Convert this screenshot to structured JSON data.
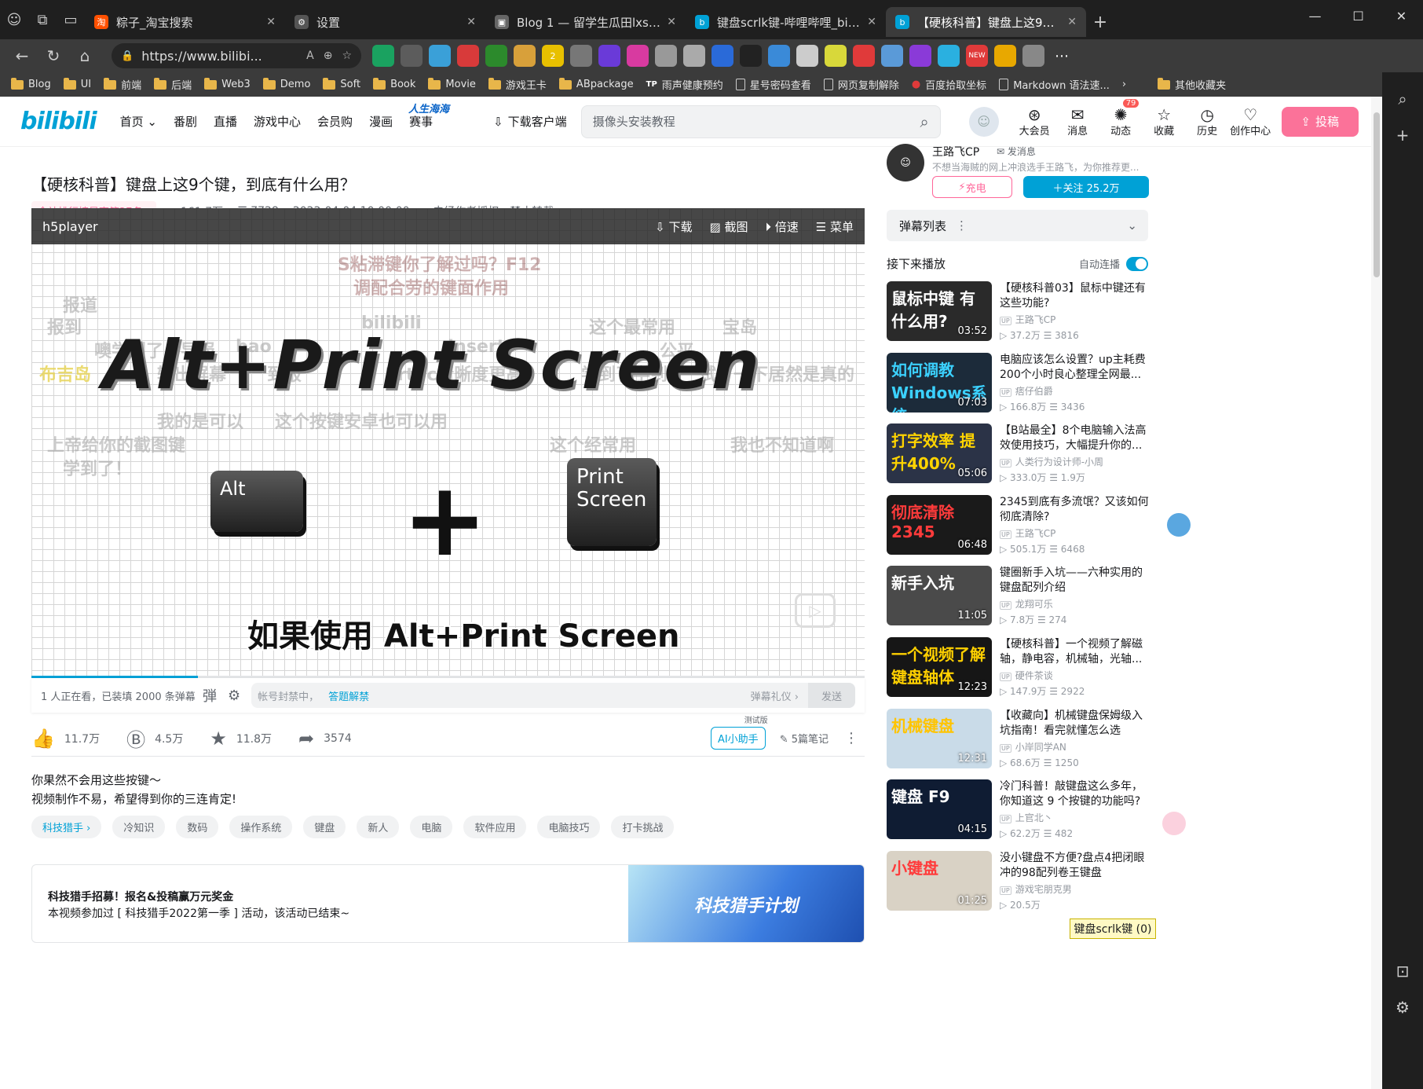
{
  "browser": {
    "tabs": [
      {
        "title": "粽子_淘宝搜索",
        "color": "#ff5000",
        "fav": "淘"
      },
      {
        "title": "设置",
        "color": "#555555",
        "fav": "⚙"
      },
      {
        "title": "Blog 1 — 留学生瓜田lxsgt.uk",
        "color": "#666666",
        "fav": "▣"
      },
      {
        "title": "键盘scrlk键-哔哩哔哩_bilibili",
        "color": "#00a1d6",
        "fav": "b"
      },
      {
        "title": "【硬核科普】键盘上这9个键，到",
        "color": "#00a1d6",
        "fav": "b"
      }
    ],
    "url": "https://www.bilibi...",
    "bookmarks": [
      "Blog",
      "UI",
      "前端",
      "后端",
      "Web3",
      "Demo",
      "Soft",
      "Book",
      "Movie",
      "游戏王卡",
      "ABpackage",
      "雨声健康预约",
      "星号密码查看",
      "网页复制解除",
      "百度拾取坐标",
      "Markdown 语法速...",
      "其他收藏夹"
    ],
    "ext_badges": {
      "count": "2",
      "new": "NEW"
    }
  },
  "header": {
    "logo": "bilibili",
    "nav": [
      "首页 ⌄",
      "番剧",
      "直播",
      "游戏中心",
      "会员购",
      "漫画",
      "赛事"
    ],
    "special": "人生海海",
    "download": "下载客户端",
    "search_placeholder": "摄像头安装教程",
    "icons": [
      {
        "label": "大会员",
        "icon": "vip-icon",
        "glyph": "⊛"
      },
      {
        "label": "消息",
        "icon": "message-icon",
        "glyph": "✉"
      },
      {
        "label": "动态",
        "icon": "dynamic-icon",
        "glyph": "✺",
        "badge": "79"
      },
      {
        "label": "收藏",
        "icon": "favorite-icon",
        "glyph": "☆"
      },
      {
        "label": "历史",
        "icon": "history-icon",
        "glyph": "◷"
      },
      {
        "label": "创作中心",
        "icon": "creator-icon",
        "glyph": "♡"
      }
    ],
    "upload": "投稿"
  },
  "video": {
    "title": "【硬核科普】键盘上这9个键，到底有什么用？",
    "rank": "全站排行榜最高第27名 ›",
    "plays": "161.7万",
    "danmaku": "7728",
    "date": "2022-04-04 10:00:00",
    "copyright": "未经作者授权，禁止转载"
  },
  "player": {
    "name": "h5player",
    "actions": [
      "下载",
      "截图",
      "倍速",
      "菜单"
    ],
    "big_text": "Alt+Print Screen",
    "key_alt": "Alt",
    "key_print_1": "Print",
    "key_print_2": "Screen",
    "subtitle": "如果使用 Alt+Print Screen",
    "progress": 0.2,
    "danmaku_items": [
      "S粘滞键你了解过吗？F12",
      "调配合劳的键面作用",
      "报道",
      "报到",
      "bilibili",
      "这个最常用",
      "宝岛",
      "噢学到了",
      "导报",
      "bao",
      "Insert",
      "公平",
      "布吉岛",
      "输出屏幕",
      "到报",
      "PrtSc清晰度更高",
      "学到了学到了",
      "试了一下居然是真的",
      "我的是可以",
      "这个按键安卓也可以用",
      "上帝给你的截图键",
      "这个经常用",
      "我也不知道啊",
      "学到了！"
    ]
  },
  "dmbar": {
    "count": "1 人正在看，已装填 2000 条弹幕",
    "prompt": "帐号封禁中，",
    "link": "答题解禁",
    "etiquette": "弹幕礼仪 ›",
    "send": "发送"
  },
  "toolbar": {
    "like": "11.7万",
    "coin": "4.5万",
    "fav": "11.8万",
    "share": "3574",
    "ai_test": "测试版",
    "ai": "AI小助手",
    "notes": "5篇笔记"
  },
  "desc": {
    "line1": "你果然不会用这些按键～",
    "line2": "视频制作不易，希望得到你的三连肯定!"
  },
  "tags": [
    "科技猎手 ›",
    "冷知识",
    "数码",
    "操作系统",
    "键盘",
    "新人",
    "电脑",
    "软件应用",
    "电脑技巧",
    "打卡挑战"
  ],
  "activity": {
    "title": "科技猎手招募！报名&投稿赢万元奖金",
    "desc": "本视频参加过 [ 科技猎手2022第一季 ] 活动，该活动已结束~",
    "banner": "科技猎手计划"
  },
  "uploader": {
    "name": "王路飞CP",
    "message": "发消息",
    "desc": "不想当海贼的网上冲浪选手王路飞，为你推荐更...",
    "charge": "充电",
    "follow": "关注 25.2万"
  },
  "right": {
    "dm_list": "弹幕列表",
    "next": "接下来播放",
    "autoplay": "自动连播"
  },
  "recommend": [
    {
      "title": "【硬核科普03】鼠标中键还有这些功能?",
      "author": "王路飞CP",
      "plays": "37.2万",
      "dm": "3816",
      "dur": "03:52",
      "thumb": "鼠标中键 有什么用?",
      "bg": "#2a2a2a",
      "color": "#ffffff"
    },
    {
      "title": "电脑应该怎么设置？up主耗费200个小时良心整理全网最...",
      "author": "痞仔伯爵",
      "plays": "166.8万",
      "dm": "3436",
      "dur": "07:03",
      "thumb": "如何调教 Windows系统",
      "bg": "#1c2b3a",
      "color": "#3bd1ff"
    },
    {
      "title": "【B站最全】8个电脑输入法高效使用技巧，大幅提升你的...",
      "author": "人类行为设计师-小周",
      "plays": "333.0万",
      "dm": "1.9万",
      "dur": "05:06",
      "thumb": "打字效率 提升400%",
      "bg": "#2b3347",
      "color": "#ffd400"
    },
    {
      "title": "2345到底有多流氓？又该如何彻底清除?",
      "author": "王路飞CP",
      "plays": "505.1万",
      "dm": "6468",
      "dur": "06:48",
      "thumb": "彻底清除 2345",
      "bg": "#1a1a1a",
      "color": "#ff3b3b"
    },
    {
      "title": "键圈新手入坑——六种实用的键盘配列介绍",
      "author": "龙翔可乐",
      "plays": "7.8万",
      "dm": "274",
      "dur": "11:05",
      "thumb": "新手入坑",
      "bg": "#4a4a4a",
      "color": "#ffffff"
    },
    {
      "title": "【硬核科普】一个视频了解磁轴，静电容，机械轴，光轴...",
      "author": "硬件茶谈",
      "plays": "147.9万",
      "dm": "2922",
      "dur": "12:23",
      "thumb": "一个视频了解键盘轴体",
      "bg": "#161616",
      "color": "#ffd000"
    },
    {
      "title": "【收藏向】机械键盘保姆级入坑指南！看完就懂怎么选",
      "author": "小岸同学AN",
      "plays": "68.6万",
      "dm": "1250",
      "dur": "12:31",
      "thumb": "机械键盘",
      "bg": "#c9dbe8",
      "color": "#ffc400"
    },
    {
      "title": "冷门科普！敲键盘这么多年，你知道这 9 个按键的功能吗?",
      "author": "上官北丶",
      "plays": "62.2万",
      "dm": "482",
      "dur": "04:15",
      "thumb": "键盘 F9",
      "bg": "#0f1c33",
      "color": "#ffffff"
    },
    {
      "title": "没小键盘不方便?盘点4把闭眼冲的98配列卷王键盘",
      "author": "游戏宅朋克男",
      "plays": "20.5万",
      "dm": "",
      "dur": "01:25",
      "thumb": "小键盘",
      "bg": "#d9d2c5",
      "color": "#ff3b3b"
    }
  ],
  "toast": "键盘scrlk键 (0)"
}
